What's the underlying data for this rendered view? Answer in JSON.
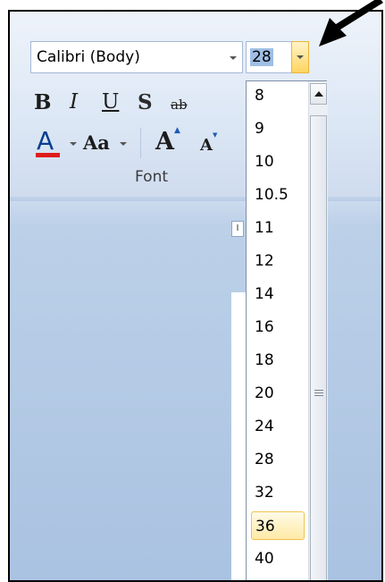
{
  "font_group": {
    "font_name": "Calibri (Body)",
    "font_size": "28",
    "group_label": "Font"
  },
  "format_buttons": {
    "bold": "B",
    "italic": "I",
    "underline": "U",
    "shadow": "S",
    "strikethrough": "ab",
    "font_color": "A",
    "change_case": "Aa",
    "grow_font": "A",
    "shrink_font": "A"
  },
  "ruler": {
    "tab_marker": "I"
  },
  "size_dropdown": {
    "items": [
      "8",
      "9",
      "10",
      "10.5",
      "11",
      "12",
      "14",
      "16",
      "18",
      "20",
      "24",
      "28",
      "32",
      "36",
      "40"
    ],
    "highlighted": "36"
  },
  "colors": {
    "font_color_bar": "#e01b1b",
    "highlight_border": "#f0c24e",
    "selected_value_bg": "#9fbfe5"
  },
  "icons": {
    "annotation_arrow": "black-arrow-icon",
    "dropdown_arrow": "chevron-down-icon",
    "scroll_up": "scroll-up-arrow-icon"
  }
}
